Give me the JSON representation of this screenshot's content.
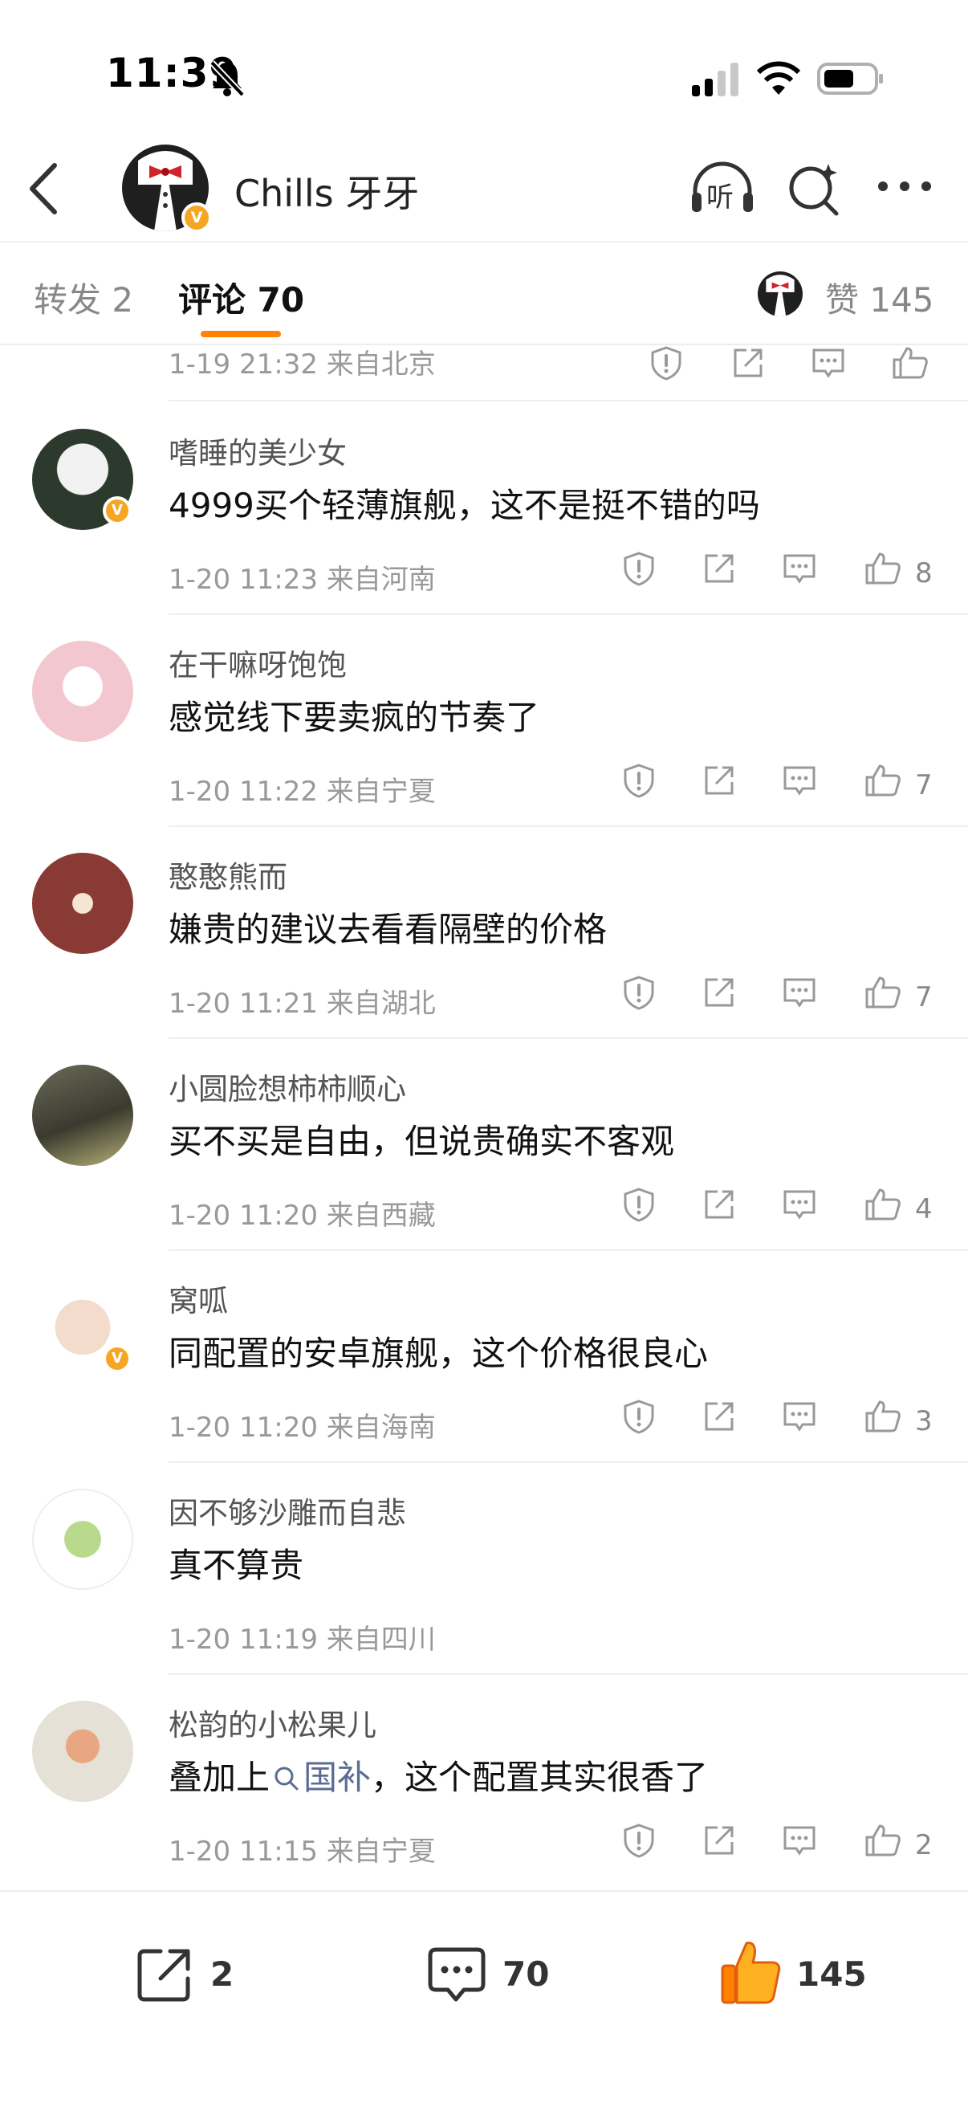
{
  "status_bar": {
    "time": "11:39"
  },
  "nav": {
    "title": "Chills 牙牙",
    "listen_label": "听"
  },
  "tabs": {
    "repost": "转发 2",
    "comments": "评论 70",
    "likes": "赞 145"
  },
  "partial_meta": "1-19 21:32  来自北京",
  "comments": [
    {
      "name": "嗜睡的美少女",
      "text": "4999买个轻薄旗舰，这不是挺不错的吗",
      "meta": "1-20 11:23  来自河南",
      "likes": "8",
      "verified": true
    },
    {
      "name": "在干嘛呀饱饱",
      "text": "感觉线下要卖疯的节奏了",
      "meta": "1-20 11:22  来自宁夏",
      "likes": "7",
      "verified": false
    },
    {
      "name": "憨憨熊而",
      "text": "嫌贵的建议去看看隔壁的价格",
      "meta": "1-20 11:21  来自湖北",
      "likes": "7",
      "verified": false
    },
    {
      "name": "小圆脸想柿柿顺心",
      "text": "买不买是自由，但说贵确实不客观",
      "meta": "1-20 11:20  来自西藏",
      "likes": "4",
      "verified": false
    },
    {
      "name": "窝呱",
      "text": "同配置的安卓旗舰，这个价格很良心",
      "meta": "1-20 11:20  来自海南",
      "likes": "3",
      "verified": true
    },
    {
      "name": "因不够沙雕而自悲",
      "text": "真不算贵",
      "meta": "1-20 11:19  来自四川",
      "likes": "",
      "verified": false
    },
    {
      "name": "松韵的小松果儿",
      "text_before": "叠加上",
      "topic": "国补",
      "text_after": "，这个配置其实很香了",
      "meta": "1-20 11:15  来自宁夏",
      "likes": "2",
      "verified": false
    }
  ],
  "bottom_bar": {
    "repost_count": "2",
    "comment_count": "70",
    "like_count": "145"
  },
  "colors": {
    "accent": "#ff8200",
    "verified": "#f6a623",
    "topic": "#5b6c93"
  }
}
